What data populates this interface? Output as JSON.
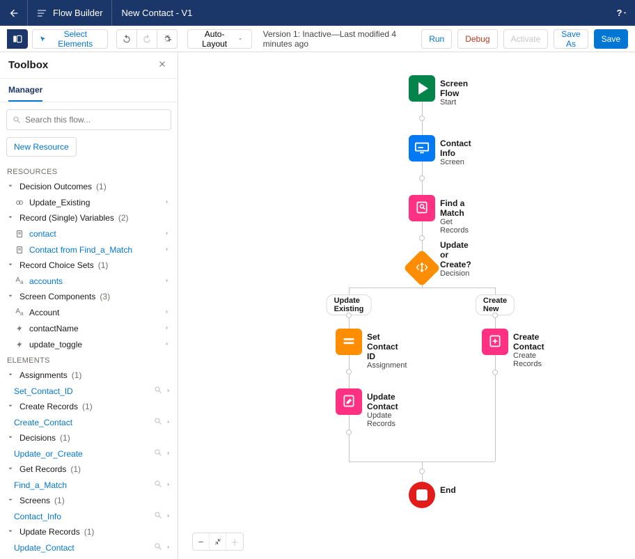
{
  "header": {
    "app_name": "Flow Builder",
    "page_title": "New Contact - V1"
  },
  "toolbar": {
    "select_elements": "Select Elements",
    "layout_mode": "Auto-Layout",
    "status": "Version 1: Inactive—Last modified 4 minutes ago",
    "run": "Run",
    "debug": "Debug",
    "activate": "Activate",
    "save_as": "Save As",
    "save": "Save"
  },
  "sidebar": {
    "title": "Toolbox",
    "tab": "Manager",
    "search_placeholder": "Search this flow...",
    "new_resource": "New Resource",
    "sections": {
      "resources": "RESOURCES",
      "elements": "ELEMENTS"
    },
    "resources": [
      {
        "label": "Decision Outcomes",
        "count": "(1)",
        "items": [
          {
            "label": "Update_Existing",
            "link": false,
            "icon": "decision-outcome-icon"
          }
        ]
      },
      {
        "label": "Record (Single) Variables",
        "count": "(2)",
        "items": [
          {
            "label": "contact",
            "link": true,
            "icon": "doc-icon"
          },
          {
            "label": "Contact from Find_a_Match",
            "link": true,
            "icon": "doc-icon"
          }
        ]
      },
      {
        "label": "Record Choice Sets",
        "count": "(1)",
        "items": [
          {
            "label": "accounts",
            "link": true,
            "icon": "text-icon"
          }
        ]
      },
      {
        "label": "Screen Components",
        "count": "(3)",
        "items": [
          {
            "label": "Account",
            "link": false,
            "icon": "text-icon"
          },
          {
            "label": "contactName",
            "link": false,
            "icon": "lightning-icon"
          },
          {
            "label": "update_toggle",
            "link": false,
            "icon": "lightning-icon"
          }
        ]
      }
    ],
    "elements": [
      {
        "label": "Assignments",
        "count": "(1)",
        "items": [
          {
            "label": "Set_Contact_ID"
          }
        ]
      },
      {
        "label": "Create Records",
        "count": "(1)",
        "items": [
          {
            "label": "Create_Contact"
          }
        ]
      },
      {
        "label": "Decisions",
        "count": "(1)",
        "items": [
          {
            "label": "Update_or_Create"
          }
        ]
      },
      {
        "label": "Get Records",
        "count": "(1)",
        "items": [
          {
            "label": "Find_a_Match"
          }
        ]
      },
      {
        "label": "Screens",
        "count": "(1)",
        "items": [
          {
            "label": "Contact_Info"
          }
        ]
      },
      {
        "label": "Update Records",
        "count": "(1)",
        "items": [
          {
            "label": "Update_Contact"
          }
        ]
      }
    ]
  },
  "chart_data": {
    "type": "flowchart",
    "nodes": [
      {
        "id": "start",
        "title": "Screen Flow",
        "subtitle": "Start",
        "kind": "start"
      },
      {
        "id": "contact_info",
        "title": "Contact Info",
        "subtitle": "Screen",
        "kind": "screen"
      },
      {
        "id": "find_match",
        "title": "Find a Match",
        "subtitle": "Get Records",
        "kind": "record"
      },
      {
        "id": "decision",
        "title": "Update or Create?",
        "subtitle": "Decision",
        "kind": "decision"
      },
      {
        "id": "set_contact_id",
        "title": "Set Contact ID",
        "subtitle": "Assignment",
        "kind": "assignment"
      },
      {
        "id": "update_contact",
        "title": "Update Contact",
        "subtitle": "Update Records",
        "kind": "record"
      },
      {
        "id": "create_contact",
        "title": "Create Contact",
        "subtitle": "Create Records",
        "kind": "record"
      },
      {
        "id": "end",
        "title": "End",
        "subtitle": "",
        "kind": "end"
      }
    ],
    "edges": [
      {
        "from": "start",
        "to": "contact_info"
      },
      {
        "from": "contact_info",
        "to": "find_match"
      },
      {
        "from": "find_match",
        "to": "decision"
      },
      {
        "from": "decision",
        "to": "set_contact_id",
        "label": "Update Existing"
      },
      {
        "from": "decision",
        "to": "create_contact",
        "label": "Create New"
      },
      {
        "from": "set_contact_id",
        "to": "update_contact"
      },
      {
        "from": "update_contact",
        "to": "end"
      },
      {
        "from": "create_contact",
        "to": "end"
      }
    ],
    "branch_labels": {
      "left": "Update Existing",
      "right": "Create New"
    }
  }
}
